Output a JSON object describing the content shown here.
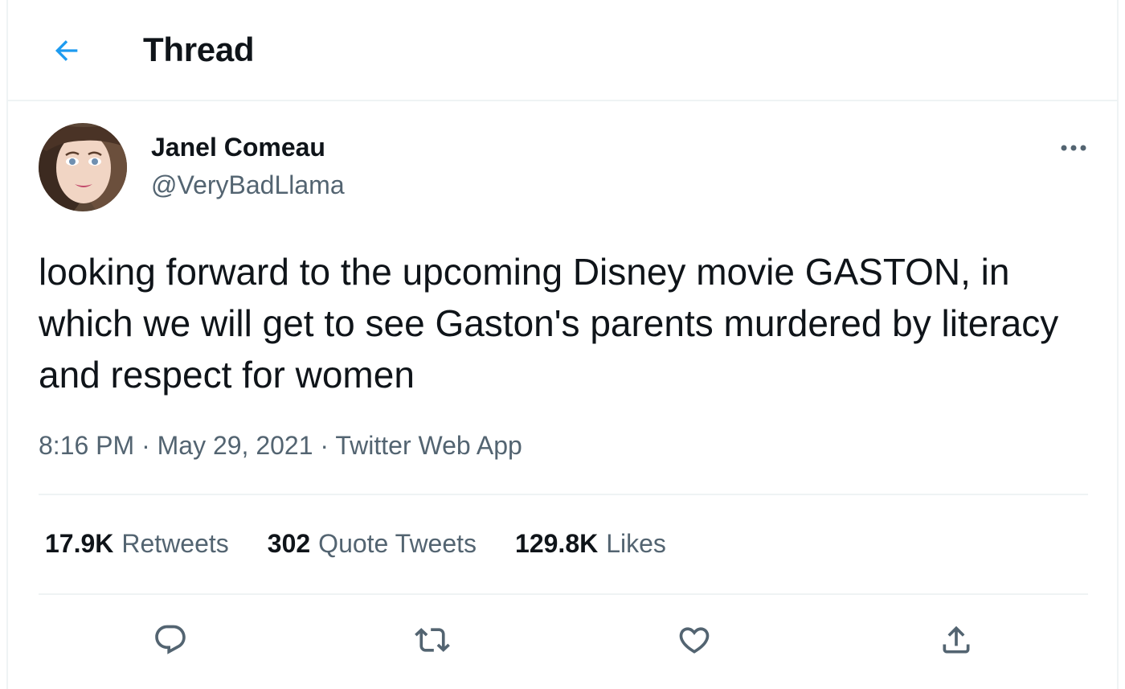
{
  "header": {
    "title": "Thread",
    "back_icon": "arrow-left-icon",
    "accent_color": "#1d9bf0"
  },
  "tweet": {
    "author": {
      "name": "Janel Comeau",
      "handle": "@VeryBadLlama"
    },
    "text": "looking forward to the upcoming Disney movie GASTON, in which we will get to see Gaston's parents murdered by literacy and respect for women",
    "time": "8:16 PM",
    "date": "May 29, 2021",
    "source": "Twitter Web App",
    "separator": "·",
    "stats": {
      "retweets_count": "17.9K",
      "retweets_label": "Retweets",
      "quotes_count": "302",
      "quotes_label": "Quote Tweets",
      "likes_count": "129.8K",
      "likes_label": "Likes"
    }
  },
  "actions": [
    "reply-icon",
    "retweet-icon",
    "like-icon",
    "share-icon"
  ],
  "colors": {
    "text_primary": "#0f1419",
    "text_secondary": "#536471",
    "border": "#eff3f4"
  }
}
